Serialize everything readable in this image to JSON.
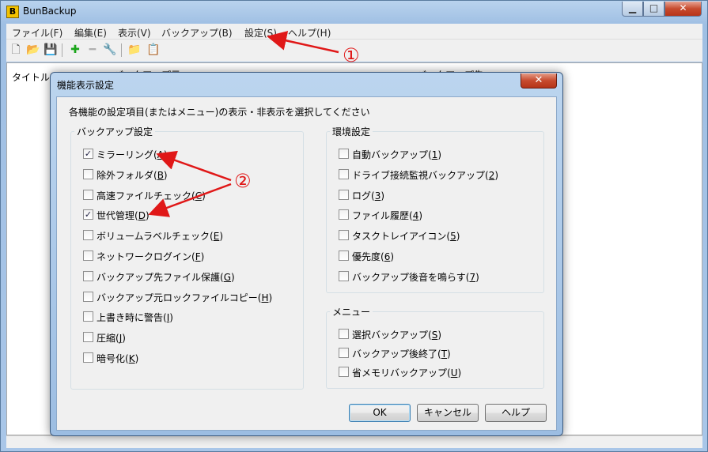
{
  "window": {
    "app_icon_glyph": "B",
    "title": "BunBackup",
    "min_glyph": "▁",
    "max_glyph": "□",
    "close_glyph": "✕"
  },
  "menu": [
    {
      "label": "ファイル(F)"
    },
    {
      "label": "編集(E)"
    },
    {
      "label": "表示(V)"
    },
    {
      "label": "バックアップ(B)"
    },
    {
      "label": "設定(S)"
    },
    {
      "label": "ヘルプ(H)"
    }
  ],
  "toolbar": [
    {
      "icon": "new-file-icon",
      "glyph": "🗋",
      "color": "#555555"
    },
    {
      "icon": "open-folder-icon",
      "glyph": "📂",
      "color": "#d9a400"
    },
    {
      "icon": "save-icon",
      "glyph": "💾",
      "color": "#2b4f9a"
    },
    {
      "icon": "add-icon",
      "glyph": "✚",
      "color": "#1aa51a"
    },
    {
      "icon": "remove-icon",
      "glyph": "━",
      "color": "#b0b0b0"
    },
    {
      "icon": "properties-icon",
      "glyph": "🔧",
      "color": "#9a9a9a"
    },
    {
      "icon": "backup-icon",
      "glyph": "📁",
      "color": "#d9a400"
    },
    {
      "icon": "backup-all-icon",
      "glyph": "📋",
      "color": "#d9a400"
    }
  ],
  "list": {
    "col_title": "タイトル",
    "col_2": "バックアップ元",
    "col_3": "バックアップ先"
  },
  "dialog": {
    "title": "機能表示設定",
    "close_glyph": "✕",
    "description": "各機能の設定項目(またはメニュー)の表示・非表示を選択してください",
    "backup_group_label": "バックアップ設定",
    "env_group_label": "環境設定",
    "menu_group_label": "メニュー",
    "backup_items": [
      {
        "label": "ミラーリング(",
        "key": "A",
        "checked": true
      },
      {
        "label": "除外フォルダ(",
        "key": "B",
        "checked": false
      },
      {
        "label": "高速ファイルチェック(",
        "key": "C",
        "checked": false
      },
      {
        "label": "世代管理(",
        "key": "D",
        "checked": true
      },
      {
        "label": "ボリュームラベルチェック(",
        "key": "E",
        "checked": false
      },
      {
        "label": "ネットワークログイン(",
        "key": "F",
        "checked": false
      },
      {
        "label": "バックアップ先ファイル保護(",
        "key": "G",
        "checked": false
      },
      {
        "label": "バックアップ元ロックファイルコピー(",
        "key": "H",
        "checked": false
      },
      {
        "label": "上書き時に警告(",
        "key": "I",
        "checked": false
      },
      {
        "label": "圧縮(",
        "key": "J",
        "checked": false
      },
      {
        "label": "暗号化(",
        "key": "K",
        "checked": false
      }
    ],
    "env_items": [
      {
        "label": "自動バックアップ(",
        "key": "1",
        "checked": false
      },
      {
        "label": "ドライブ接続監視バックアップ(",
        "key": "2",
        "checked": false
      },
      {
        "label": "ログ(",
        "key": "3",
        "checked": false
      },
      {
        "label": "ファイル履歴(",
        "key": "4",
        "checked": false
      },
      {
        "label": "タスクトレイアイコン(",
        "key": "5",
        "checked": false
      },
      {
        "label": "優先度(",
        "key": "6",
        "checked": false
      },
      {
        "label": "バックアップ後音を鳴らす(",
        "key": "7",
        "checked": false
      }
    ],
    "menu_items": [
      {
        "label": "選択バックアップ(",
        "key": "S",
        "checked": false
      },
      {
        "label": "バックアップ後終了(",
        "key": "T",
        "checked": false
      },
      {
        "label": "省メモリバックアップ(",
        "key": "U",
        "checked": false
      }
    ],
    "ok_label": "OK",
    "cancel_label": "キャンセル",
    "help_label": "ヘルプ"
  },
  "annotations": {
    "marker_1": "①",
    "marker_2": "②",
    "color": "#e01818"
  }
}
